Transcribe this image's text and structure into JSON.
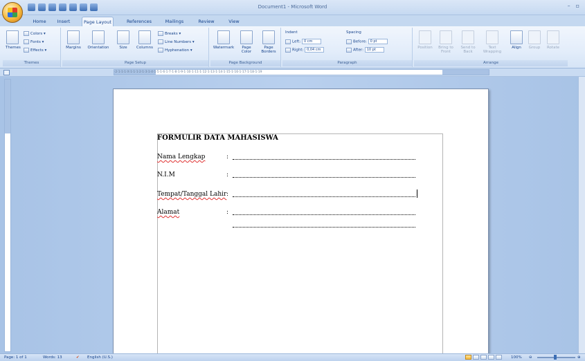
{
  "window": {
    "title": "Document1 - Microsoft Word",
    "controls": [
      "–",
      "▫"
    ]
  },
  "tabs": [
    "Home",
    "Insert",
    "Page Layout",
    "References",
    "Mailings",
    "Review",
    "View"
  ],
  "active_tab": "Page Layout",
  "ribbon": {
    "themes": {
      "label": "Themes",
      "big_button": "Themes",
      "colors": "Colors ▾",
      "fonts": "Fonts ▾",
      "effects": "Effects ▾"
    },
    "page_setup": {
      "label": "Page Setup",
      "margins": "Margins",
      "orientation": "Orientation",
      "size": "Size",
      "columns": "Columns",
      "breaks": "Breaks ▾",
      "line_numbers": "Line Numbers ▾",
      "hyphenation": "Hyphenation ▾"
    },
    "page_background": {
      "label": "Page Background",
      "watermark": "Watermark",
      "page_color": "Page Color",
      "page_borders": "Page Borders"
    },
    "paragraph": {
      "label": "Paragraph",
      "indent_title": "Indent",
      "left_label": "Left:",
      "left_value": "0 cm",
      "right_label": "Right:",
      "right_value": "0,04 cm",
      "spacing_title": "Spacing",
      "before_label": "Before:",
      "before_value": "0 pt",
      "after_label": "After:",
      "after_value": "10 pt"
    },
    "arrange": {
      "label": "Arrange",
      "position": "Position",
      "bring_to_front": "Bring to Front",
      "send_to_back": "Send to Back",
      "text_wrapping": "Text Wrapping",
      "align": "Align",
      "group": "Group",
      "rotate": "Rotate"
    }
  },
  "ruler_text": "·2·1·1·1·X·1·1·1·2·1·3·1·4·1·5·1·6·1·7·1·8·1·9·1·10·1·11·1·12·1·13·1·14·1·15·1·16·1·17·1·18·1·19",
  "document": {
    "title": "FORMULIR DATA MAHASISWA",
    "fields": [
      {
        "label": "Nama Lengkap",
        "colon": ":"
      },
      {
        "label": "N.I.M",
        "colon": ":"
      },
      {
        "label": "Tempat/Tanggal Lahir",
        "colon": ":"
      },
      {
        "label": "Alamat",
        "colon": ":"
      }
    ]
  },
  "status": {
    "page": "Page: 1 of 1",
    "words": "Words: 13",
    "language": "English (U.S.)",
    "zoom": "100%"
  }
}
